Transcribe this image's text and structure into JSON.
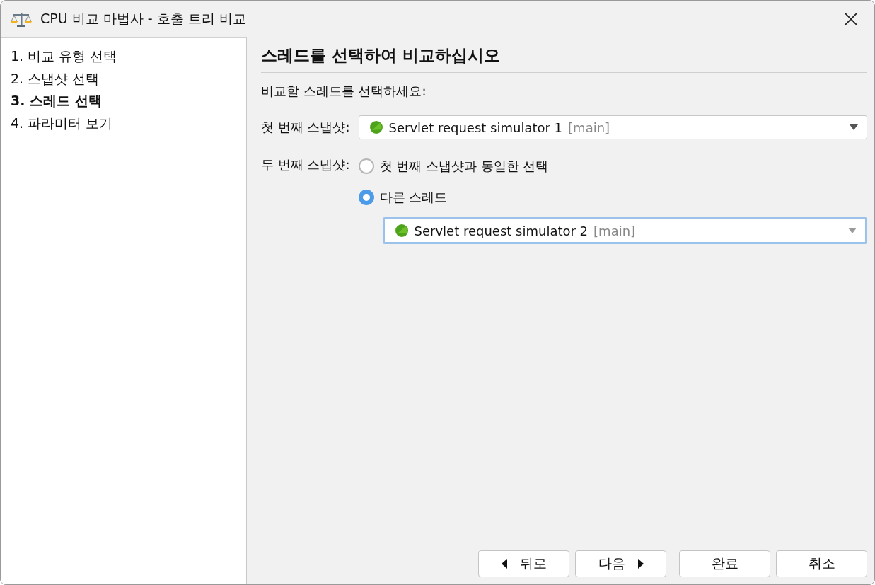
{
  "window": {
    "title": "CPU 비교 마법사 - 호출 트리 비교"
  },
  "steps": [
    {
      "label": "1. 비교 유형 선택",
      "selected": false
    },
    {
      "label": "2. 스냅샷 선택",
      "selected": false
    },
    {
      "label": "3. 스레드 선택",
      "selected": true
    },
    {
      "label": "4. 파라미터 보기",
      "selected": false
    }
  ],
  "heading": "스레드를 선택하여 비교하십시오",
  "instruction": "비교할 스레드를 선택하세요:",
  "first_snapshot": {
    "label": "첫 번째 스냅샷:",
    "value": "Servlet request simulator 1",
    "suffix": "[main]",
    "focused": false
  },
  "second_snapshot": {
    "label": "두 번째 스냅샷:",
    "options": [
      {
        "label": "첫 번째 스냅샷과 동일한 선택",
        "selected": false
      },
      {
        "label": "다른 스레드",
        "selected": true
      }
    ],
    "dropdown": {
      "value": "Servlet request simulator 2",
      "suffix": "[main]",
      "focused": true
    }
  },
  "buttons": [
    {
      "label": "뒤로",
      "kind": "back"
    },
    {
      "label": "다음",
      "kind": "next"
    },
    {
      "label": "완료",
      "kind": "plain"
    },
    {
      "label": "취소",
      "kind": "plain"
    }
  ]
}
